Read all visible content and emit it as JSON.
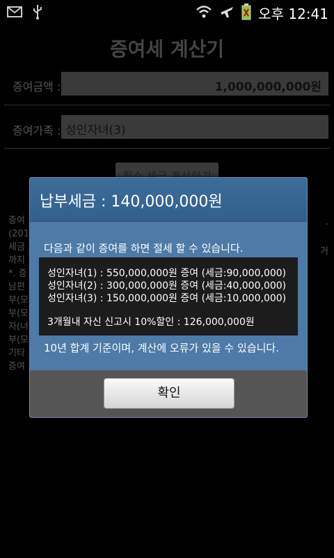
{
  "status_bar": {
    "time": "오후 12:41",
    "icons": [
      "mail-icon",
      "usb-icon",
      "wifi-icon",
      "airplane-icon",
      "battery-icon"
    ]
  },
  "app": {
    "title": "증여세 계산기",
    "amount_label": "증여금액 :",
    "amount_value": "1,000,000,000원",
    "family_label": "증여가족 :",
    "family_value": "성인자녀(3)",
    "calc_button_label": "최소 세금 계산하기",
    "bg_lines": [
      "증여",
      "(201",
      "세금",
      "까지",
      "*. 증",
      "남편",
      "부(모",
      "부(모",
      "자(녀",
      "부(모",
      "기타",
      "증여"
    ],
    "bg_right": [
      ".",
      "거"
    ]
  },
  "dialog": {
    "title": "납부세금 : 140,000,000원",
    "message": "다음과 같이 증여를 하면 절세 할 수 있습니다.",
    "lines": [
      "성인자녀(1) : 550,000,000원 증여 (세금:90,000,000)",
      "성인자녀(2) : 300,000,000원 증여 (세금:40,000,000)",
      "성인자녀(3) : 150,000,000원 증여 (세금:10,000,000)"
    ],
    "discount": "3개월내 자신 신고시 10%할인 : 126,000,000원",
    "note": "10년 합계 기준이며, 계산에 오류가 있을 수 있습니다.",
    "ok_label": "확인"
  }
}
